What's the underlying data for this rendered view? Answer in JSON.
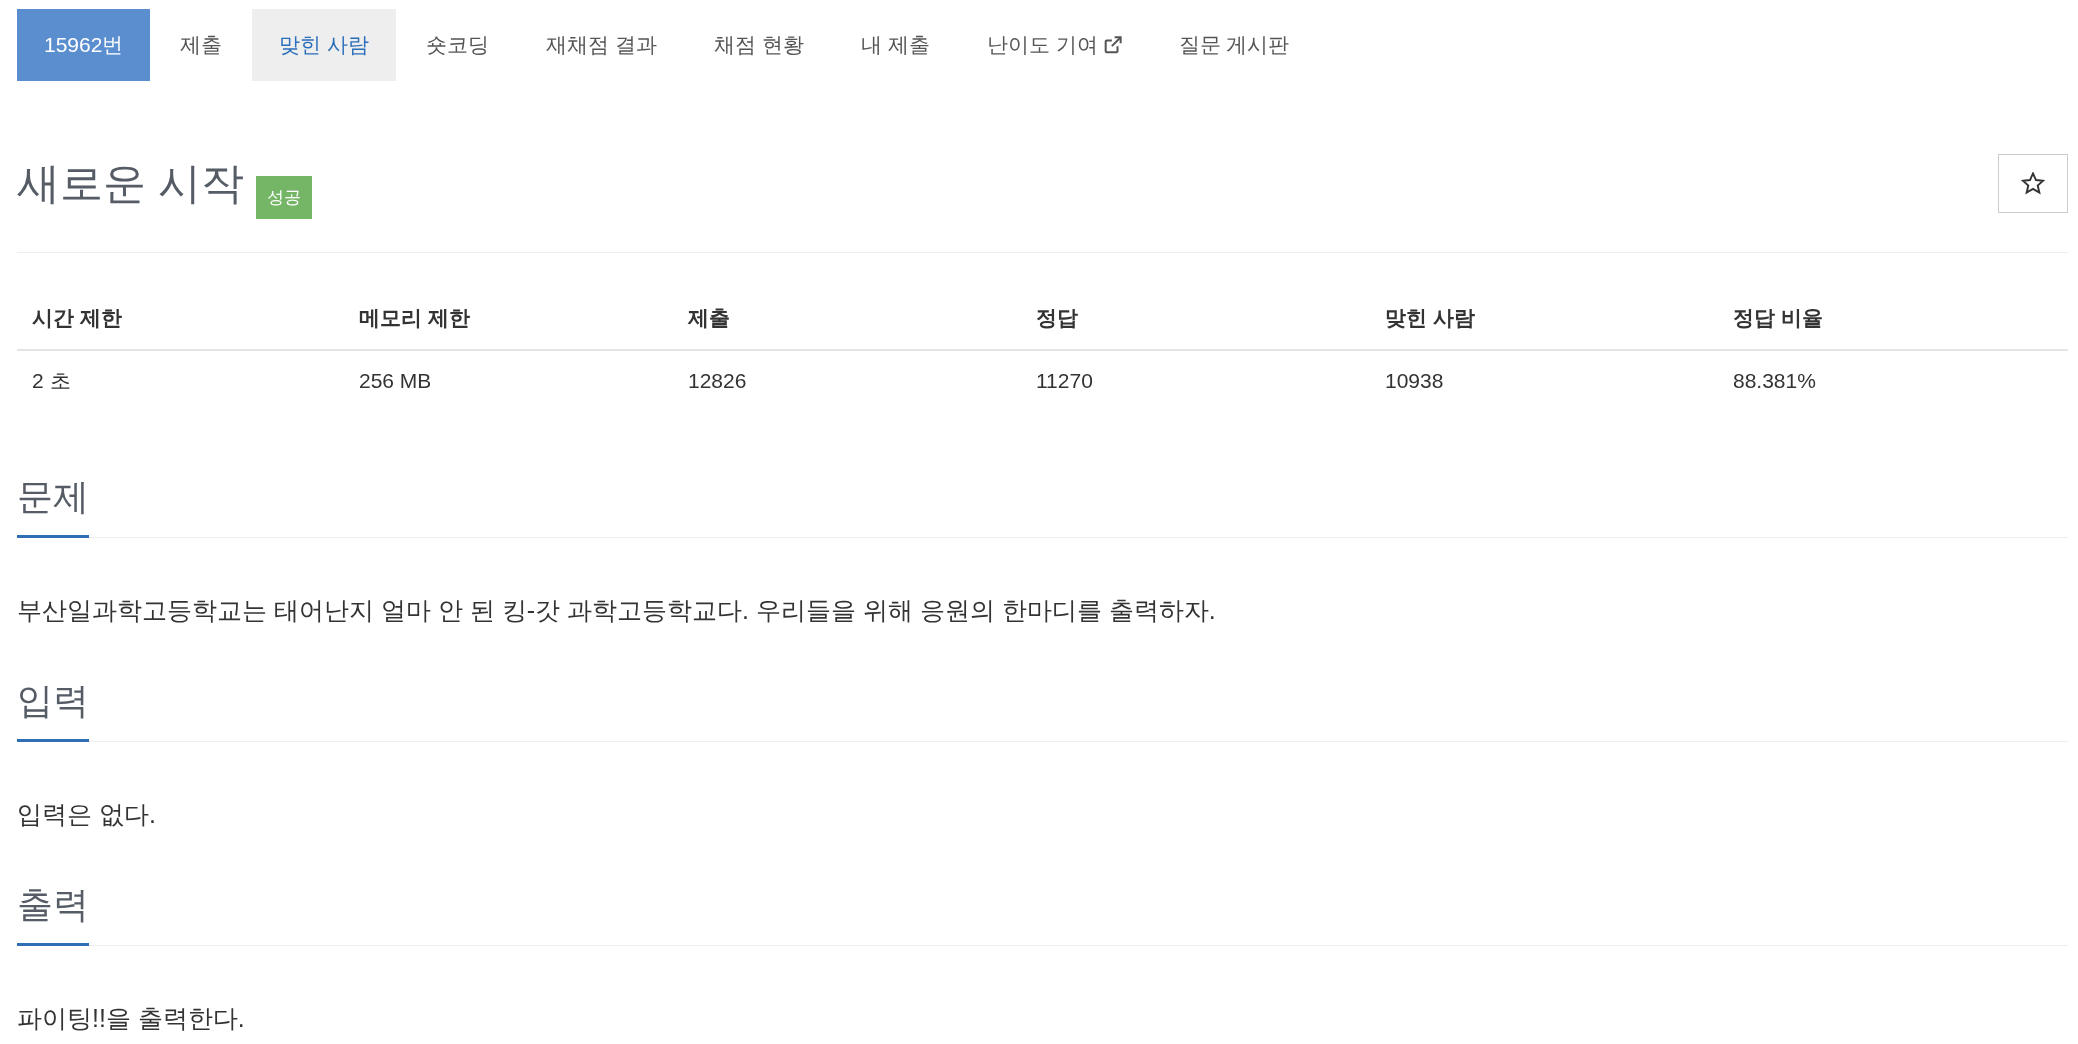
{
  "nav": {
    "tabs": [
      {
        "label": "15962번",
        "selected": true,
        "highlighted": false,
        "external": false
      },
      {
        "label": "제출",
        "selected": false,
        "highlighted": false,
        "external": false
      },
      {
        "label": "맞힌 사람",
        "selected": false,
        "highlighted": true,
        "external": false
      },
      {
        "label": "숏코딩",
        "selected": false,
        "highlighted": false,
        "external": false
      },
      {
        "label": "재채점 결과",
        "selected": false,
        "highlighted": false,
        "external": false
      },
      {
        "label": "채점 현황",
        "selected": false,
        "highlighted": false,
        "external": false
      },
      {
        "label": "내 제출",
        "selected": false,
        "highlighted": false,
        "external": false
      },
      {
        "label": "난이도 기여",
        "selected": false,
        "highlighted": false,
        "external": true
      },
      {
        "label": "질문 게시판",
        "selected": false,
        "highlighted": false,
        "external": false
      }
    ]
  },
  "problem": {
    "title": "새로운 시작",
    "badge": "성공",
    "starred": false
  },
  "table": {
    "columns": [
      "시간 제한",
      "메모리 제한",
      "제출",
      "정답",
      "맞힌 사람",
      "정답 비율"
    ],
    "rows": [
      [
        "2 초",
        "256 MB",
        "12826",
        "11270",
        "10938",
        "88.381%"
      ]
    ]
  },
  "sections": [
    {
      "heading": "문제",
      "text": "부산일과학고등학교는 태어난지 얼마 안 된 킹-갓 과학고등학교다. 우리들을 위해 응원의 한마디를 출력하자."
    },
    {
      "heading": "입력",
      "text": "입력은 없다."
    },
    {
      "heading": "출력",
      "text": "파이팅!!을 출력한다."
    }
  ]
}
